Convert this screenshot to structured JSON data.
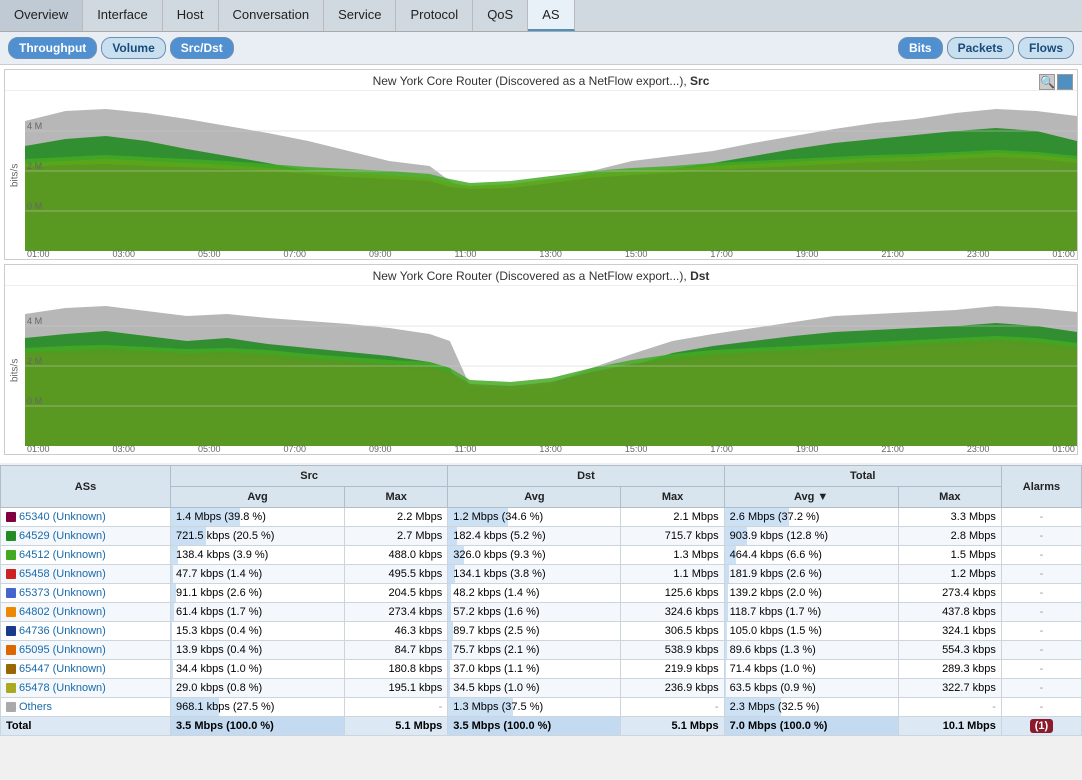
{
  "nav": {
    "items": [
      {
        "label": "Overview",
        "active": false
      },
      {
        "label": "Interface",
        "active": false
      },
      {
        "label": "Host",
        "active": false
      },
      {
        "label": "Conversation",
        "active": false
      },
      {
        "label": "Service",
        "active": false
      },
      {
        "label": "Protocol",
        "active": false
      },
      {
        "label": "QoS",
        "active": false
      },
      {
        "label": "AS",
        "active": true
      }
    ]
  },
  "subnav_left": [
    {
      "label": "Throughput",
      "active": true
    },
    {
      "label": "Volume",
      "active": false
    },
    {
      "label": "Src/Dst",
      "active": true
    }
  ],
  "subnav_right": [
    {
      "label": "Bits",
      "active": true
    },
    {
      "label": "Packets",
      "active": false
    },
    {
      "label": "Flows",
      "active": false
    }
  ],
  "chart_src": {
    "title": "New York Core Router (Discovered as a NetFlow export...)",
    "suffix": "Src"
  },
  "chart_dst": {
    "title": "New York Core Router (Discovered as a NetFlow export...)",
    "suffix": "Dst"
  },
  "y_label": "bits/s",
  "x_ticks": [
    "01:00",
    "03:00",
    "05:00",
    "07:00",
    "09:00",
    "11:00",
    "13:00",
    "15:00",
    "17:00",
    "19:00",
    "21:00",
    "23:00",
    "01:00"
  ],
  "table": {
    "group_headers": [
      "",
      "Src",
      "",
      "Dst",
      "",
      "Total",
      "",
      ""
    ],
    "col_headers": [
      "ASs",
      "Avg",
      "Max",
      "Avg",
      "Max",
      "Avg ▼",
      "Max",
      "Alarms"
    ],
    "rows": [
      {
        "color": "#800040",
        "name": "65340 (Unknown)",
        "src_avg": "1.4 Mbps (39.8 %)",
        "src_avg_pct": 39.8,
        "src_max": "2.2 Mbps",
        "dst_avg": "1.2 Mbps (34.6 %)",
        "dst_avg_pct": 34.6,
        "dst_max": "2.1 Mbps",
        "tot_avg": "2.6 Mbps (37.2 %)",
        "tot_avg_pct": 37.2,
        "tot_max": "3.3 Mbps",
        "alarm": "-"
      },
      {
        "color": "#228B22",
        "name": "64529 (Unknown)",
        "src_avg": "721.5 kbps (20.5 %)",
        "src_avg_pct": 20.5,
        "src_max": "2.7 Mbps",
        "dst_avg": "182.4 kbps (5.2 %)",
        "dst_avg_pct": 5.2,
        "dst_max": "715.7 kbps",
        "tot_avg": "903.9 kbps (12.8 %)",
        "tot_avg_pct": 12.8,
        "tot_max": "2.8 Mbps",
        "alarm": "-"
      },
      {
        "color": "#44aa22",
        "name": "64512 (Unknown)",
        "src_avg": "138.4 kbps (3.9 %)",
        "src_avg_pct": 3.9,
        "src_max": "488.0 kbps",
        "dst_avg": "326.0 kbps (9.3 %)",
        "dst_avg_pct": 9.3,
        "dst_max": "1.3 Mbps",
        "tot_avg": "464.4 kbps (6.6 %)",
        "tot_avg_pct": 6.6,
        "tot_max": "1.5 Mbps",
        "alarm": "-"
      },
      {
        "color": "#cc2222",
        "name": "65458 (Unknown)",
        "src_avg": "47.7 kbps (1.4 %)",
        "src_avg_pct": 1.4,
        "src_max": "495.5 kbps",
        "dst_avg": "134.1 kbps (3.8 %)",
        "dst_avg_pct": 3.8,
        "dst_max": "1.1 Mbps",
        "tot_avg": "181.9 kbps (2.6 %)",
        "tot_avg_pct": 2.6,
        "tot_max": "1.2 Mbps",
        "alarm": "-"
      },
      {
        "color": "#4466cc",
        "name": "65373 (Unknown)",
        "src_avg": "91.1 kbps (2.6 %)",
        "src_avg_pct": 2.6,
        "src_max": "204.5 kbps",
        "dst_avg": "48.2 kbps (1.4 %)",
        "dst_avg_pct": 1.4,
        "dst_max": "125.6 kbps",
        "tot_avg": "139.2 kbps (2.0 %)",
        "tot_avg_pct": 2.0,
        "tot_max": "273.4 kbps",
        "alarm": "-"
      },
      {
        "color": "#ee8800",
        "name": "64802 (Unknown)",
        "src_avg": "61.4 kbps (1.7 %)",
        "src_avg_pct": 1.7,
        "src_max": "273.4 kbps",
        "dst_avg": "57.2 kbps (1.6 %)",
        "dst_avg_pct": 1.6,
        "dst_max": "324.6 kbps",
        "tot_avg": "118.7 kbps (1.7 %)",
        "tot_avg_pct": 1.7,
        "tot_max": "437.8 kbps",
        "alarm": "-"
      },
      {
        "color": "#1a3a8a",
        "name": "64736 (Unknown)",
        "src_avg": "15.3 kbps (0.4 %)",
        "src_avg_pct": 0.4,
        "src_max": "46.3 kbps",
        "dst_avg": "89.7 kbps (2.5 %)",
        "dst_avg_pct": 2.5,
        "dst_max": "306.5 kbps",
        "tot_avg": "105.0 kbps (1.5 %)",
        "tot_avg_pct": 1.5,
        "tot_max": "324.1 kbps",
        "alarm": "-"
      },
      {
        "color": "#dd6600",
        "name": "65095 (Unknown)",
        "src_avg": "13.9 kbps (0.4 %)",
        "src_avg_pct": 0.4,
        "src_max": "84.7 kbps",
        "dst_avg": "75.7 kbps (2.1 %)",
        "dst_avg_pct": 2.1,
        "dst_max": "538.9 kbps",
        "tot_avg": "89.6 kbps (1.3 %)",
        "tot_avg_pct": 1.3,
        "tot_max": "554.3 kbps",
        "alarm": "-"
      },
      {
        "color": "#996600",
        "name": "65447 (Unknown)",
        "src_avg": "34.4 kbps (1.0 %)",
        "src_avg_pct": 1.0,
        "src_max": "180.8 kbps",
        "dst_avg": "37.0 kbps (1.1 %)",
        "dst_avg_pct": 1.1,
        "dst_max": "219.9 kbps",
        "tot_avg": "71.4 kbps (1.0 %)",
        "tot_avg_pct": 1.0,
        "tot_max": "289.3 kbps",
        "alarm": "-"
      },
      {
        "color": "#aaaa22",
        "name": "65478 (Unknown)",
        "src_avg": "29.0 kbps (0.8 %)",
        "src_avg_pct": 0.8,
        "src_max": "195.1 kbps",
        "dst_avg": "34.5 kbps (1.0 %)",
        "dst_avg_pct": 1.0,
        "dst_max": "236.9 kbps",
        "tot_avg": "63.5 kbps (0.9 %)",
        "tot_avg_pct": 0.9,
        "tot_max": "322.7 kbps",
        "alarm": "-"
      },
      {
        "color": "#aaaaaa",
        "name": "Others",
        "src_avg": "968.1 kbps (27.5 %)",
        "src_avg_pct": 27.5,
        "src_max": "-",
        "dst_avg": "1.3 Mbps (37.5 %)",
        "dst_avg_pct": 37.5,
        "dst_max": "-",
        "tot_avg": "2.3 Mbps (32.5 %)",
        "tot_avg_pct": 32.5,
        "tot_max": "-",
        "alarm": "-"
      },
      {
        "color": null,
        "name": "Total",
        "src_avg": "3.5 Mbps (100.0 %)",
        "src_avg_pct": 100,
        "src_max": "5.1 Mbps",
        "dst_avg": "3.5 Mbps (100.0 %)",
        "dst_avg_pct": 100,
        "dst_max": "5.1 Mbps",
        "tot_avg": "7.0 Mbps (100.0 %)",
        "tot_avg_pct": 100,
        "tot_max": "10.1 Mbps",
        "alarm": "(1)",
        "is_total": true
      }
    ]
  }
}
